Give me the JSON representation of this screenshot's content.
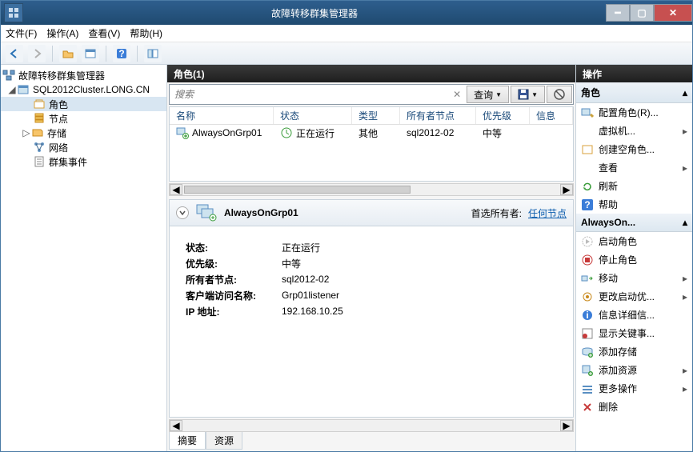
{
  "window": {
    "title": "故障转移群集管理器"
  },
  "menu": {
    "file": "文件(F)",
    "action": "操作(A)",
    "view": "查看(V)",
    "help": "帮助(H)"
  },
  "tree": {
    "root": "故障转移群集管理器",
    "cluster": "SQL2012Cluster.LONG.CN",
    "roles": "角色",
    "nodes": "节点",
    "storage": "存储",
    "network": "网络",
    "events": "群集事件"
  },
  "rolesPanel": {
    "header": "角色(1)",
    "search_placeholder": "搜索",
    "query_btn": "查询",
    "columns": {
      "name": "名称",
      "status": "状态",
      "type": "类型",
      "owner": "所有者节点",
      "priority": "优先级",
      "info": "信息"
    },
    "row": {
      "name": "AlwaysOnGrp01",
      "status": "正在运行",
      "type": "其他",
      "owner": "sql2012-02",
      "priority": "中等",
      "info": ""
    }
  },
  "detail": {
    "title": "AlwaysOnGrp01",
    "pref_owner_label": "首选所有者:",
    "pref_owner_link": "任何节点",
    "rows": {
      "status_l": "状态:",
      "status_v": "正在运行",
      "priority_l": "优先级:",
      "priority_v": "中等",
      "owner_l": "所有者节点:",
      "owner_v": "sql2012-02",
      "client_l": "客户端访问名称:",
      "client_v": "Grp01listener",
      "ip_l": "IP 地址:",
      "ip_v": "192.168.10.25"
    },
    "tab_summary": "摘要",
    "tab_resource": "资源"
  },
  "actions": {
    "header": "操作",
    "sec_roles": "角色",
    "configure": "配置角色(R)...",
    "vm": "虚拟机...",
    "create_empty": "创建空角色...",
    "view": "查看",
    "refresh": "刷新",
    "help": "帮助",
    "sec_always": "AlwaysOn...",
    "start": "启动角色",
    "stop": "停止角色",
    "move": "移动",
    "change_start": "更改启动优...",
    "info_detail": "信息详细信...",
    "show_crit": "显示关键事...",
    "add_storage": "添加存储",
    "add_resource": "添加资源",
    "more_ops": "更多操作",
    "delete": "删除"
  }
}
